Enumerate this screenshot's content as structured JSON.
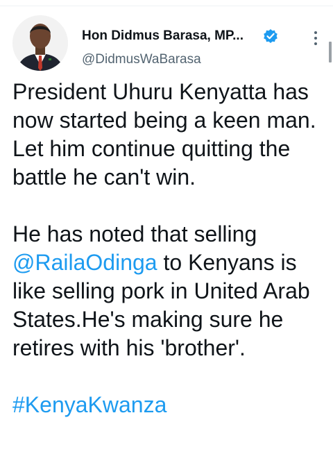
{
  "tweet": {
    "author": {
      "display_name": "Hon Didmus Barasa, MP...",
      "handle": "@DidmusWaBarasa",
      "verified": true
    },
    "paragraph_1": "President Uhuru Kenyatta has now started being a keen man. Let him continue quitting the battle he can't win.",
    "paragraph_2_before": "He has noted that selling ",
    "paragraph_2_mention": "@RailaOdinga",
    "paragraph_2_after": " to Kenyans is like selling pork in United Arab States.He's making sure he retires with his 'brother'.",
    "hashtag": "#KenyaKwanza"
  },
  "colors": {
    "text": "#0f1419",
    "secondary": "#536471",
    "link": "#1d9bf0",
    "verified": "#1d9bf0"
  },
  "icons": {
    "verified": "verified-badge-icon",
    "more": "more-vertical-icon"
  }
}
